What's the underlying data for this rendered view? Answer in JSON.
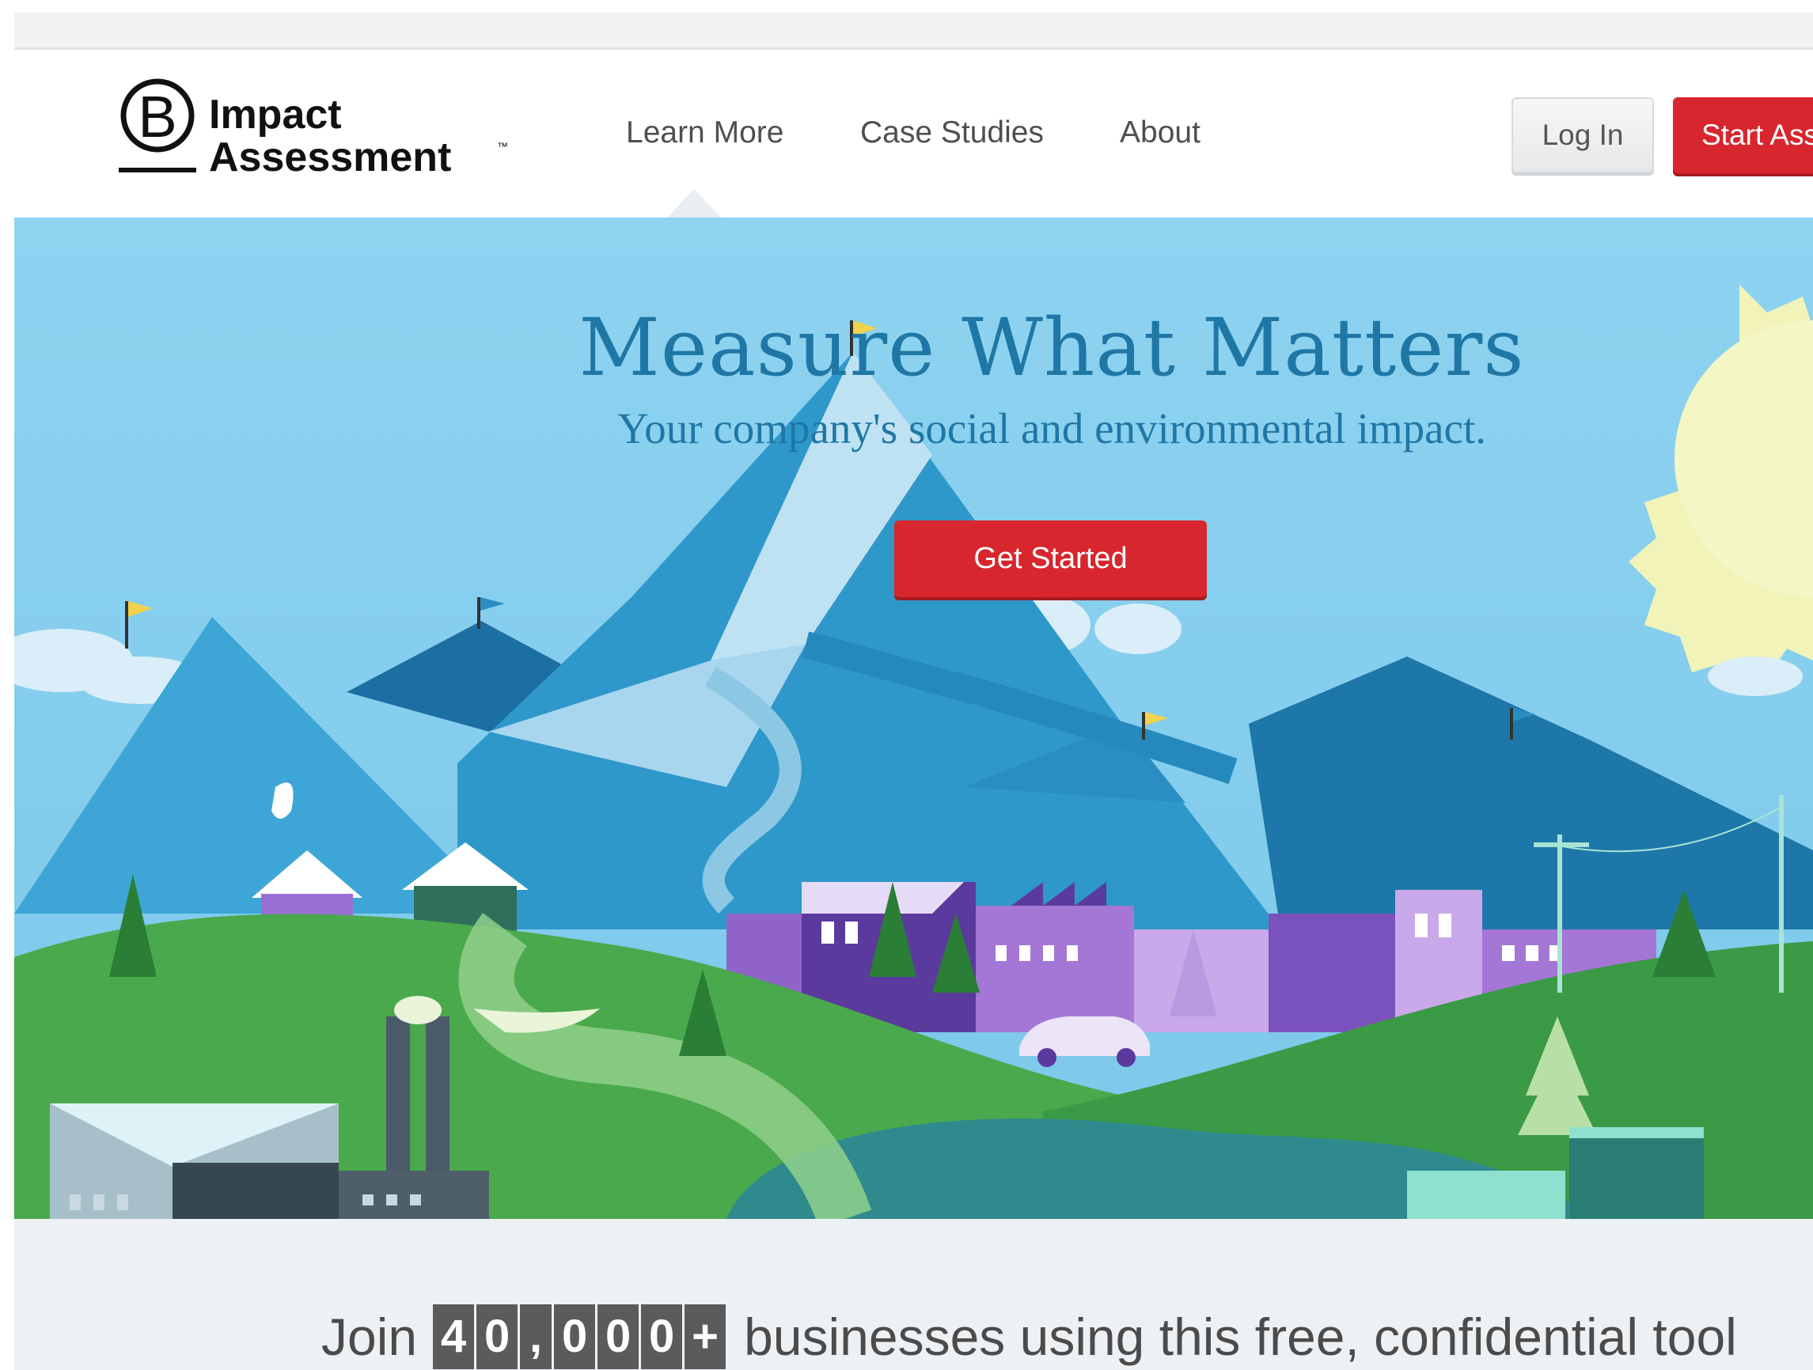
{
  "brand": {
    "logo_letter": "B",
    "logo_line1": "Impact",
    "logo_line2": "Assessment",
    "trademark": "™"
  },
  "nav": {
    "links": [
      "Learn More",
      "Case Studies",
      "About"
    ],
    "active_link": "Learn More",
    "login_label": "Log In",
    "start_label": "Start Assessment"
  },
  "hero": {
    "title": "Measure What Matters",
    "subtitle": "Your company's social and environmental impact.",
    "cta_label": "Get Started"
  },
  "stats": {
    "prefix": "Join",
    "digits": [
      "4",
      "0",
      ",",
      "0",
      "0",
      "0",
      "+"
    ],
    "suffix": "businesses using this free, confidential tool"
  },
  "colors": {
    "accent_red": "#d7262d",
    "hero_title": "#1f77a6",
    "sky": "#86cfee"
  }
}
